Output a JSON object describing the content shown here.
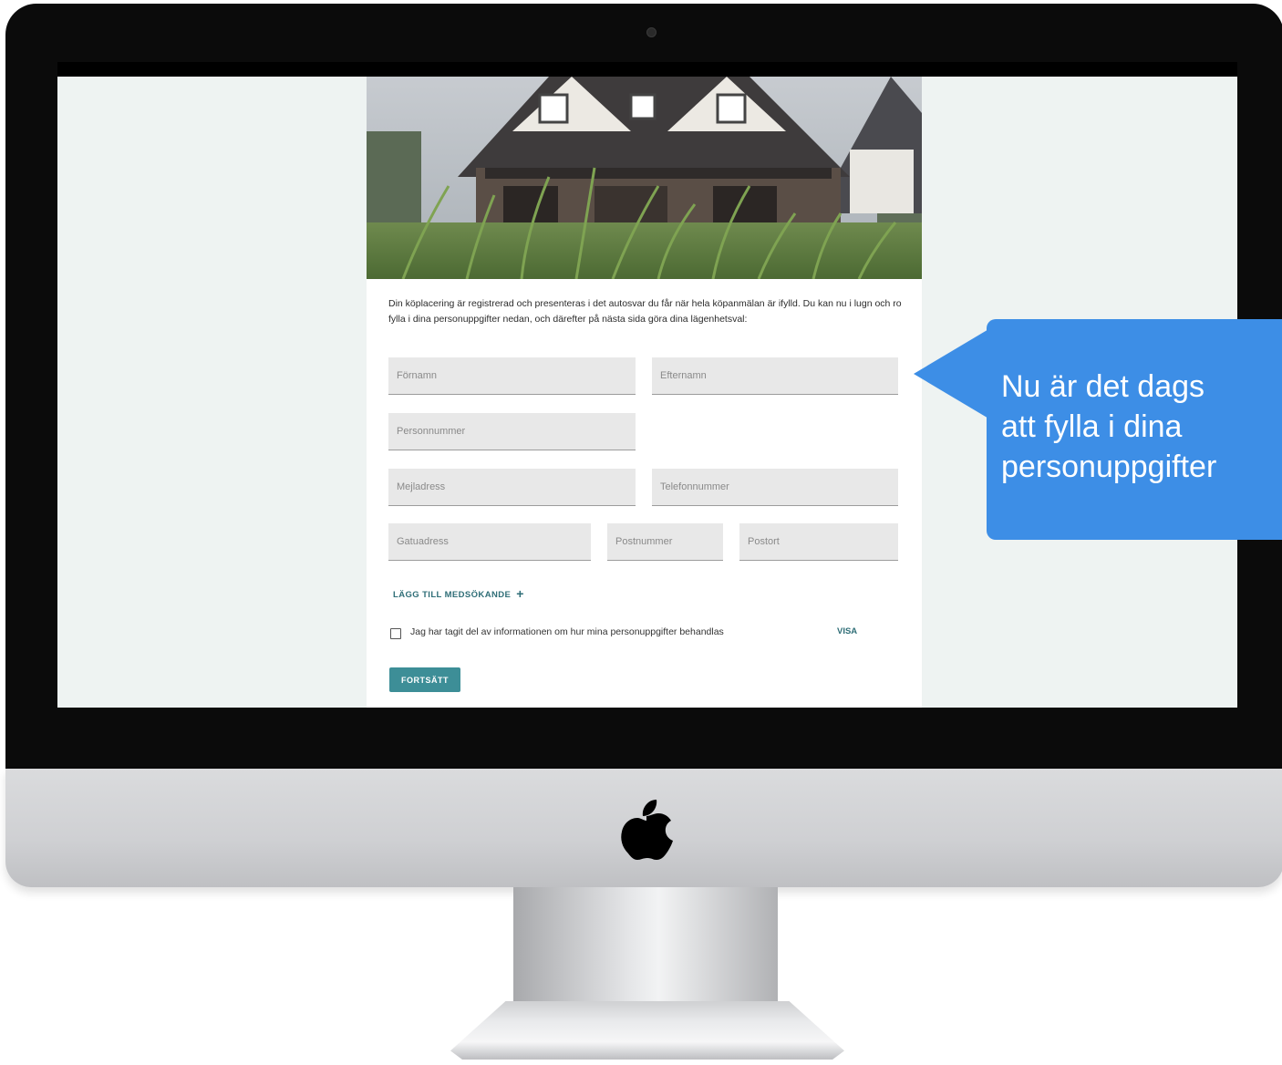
{
  "form": {
    "intro_text": "Din köplacering är registrerad och presenteras i det autosvar du får när hela köpanmälan är ifylld. Du kan nu i lugn och ro fylla i dina personuppgifter nedan, och därefter på nästa sida göra dina lägenhetsval:",
    "fields": {
      "first_name": "Förnamn",
      "last_name": "Efternamn",
      "personal_number": "Personnummer",
      "email": "Mejladress",
      "phone": "Telefonnummer",
      "street_address": "Gatuadress",
      "postal_code": "Postnummer",
      "city": "Postort"
    },
    "add_co_applicant": "LÄGG TILL MEDSÖKANDE",
    "add_co_applicant_icon": "+",
    "consent_label": "Jag har tagit del av informationen om hur mina personuppgifter behandlas",
    "consent_checked": false,
    "show_link": "VISA",
    "continue_button": "FORTSÄTT"
  },
  "callout": {
    "text": "Nu är det dags\natt fylla i dina\npersonuppgifter"
  },
  "colors": {
    "accent": "#3d8e97",
    "link": "#2f6e77",
    "callout": "#3d8ee6",
    "page_background": "#eef3f2"
  },
  "icons": {
    "device": "imac-frame",
    "logo": "apple-logo-icon",
    "add": "plus-icon",
    "checkbox": "checkbox-icon"
  }
}
